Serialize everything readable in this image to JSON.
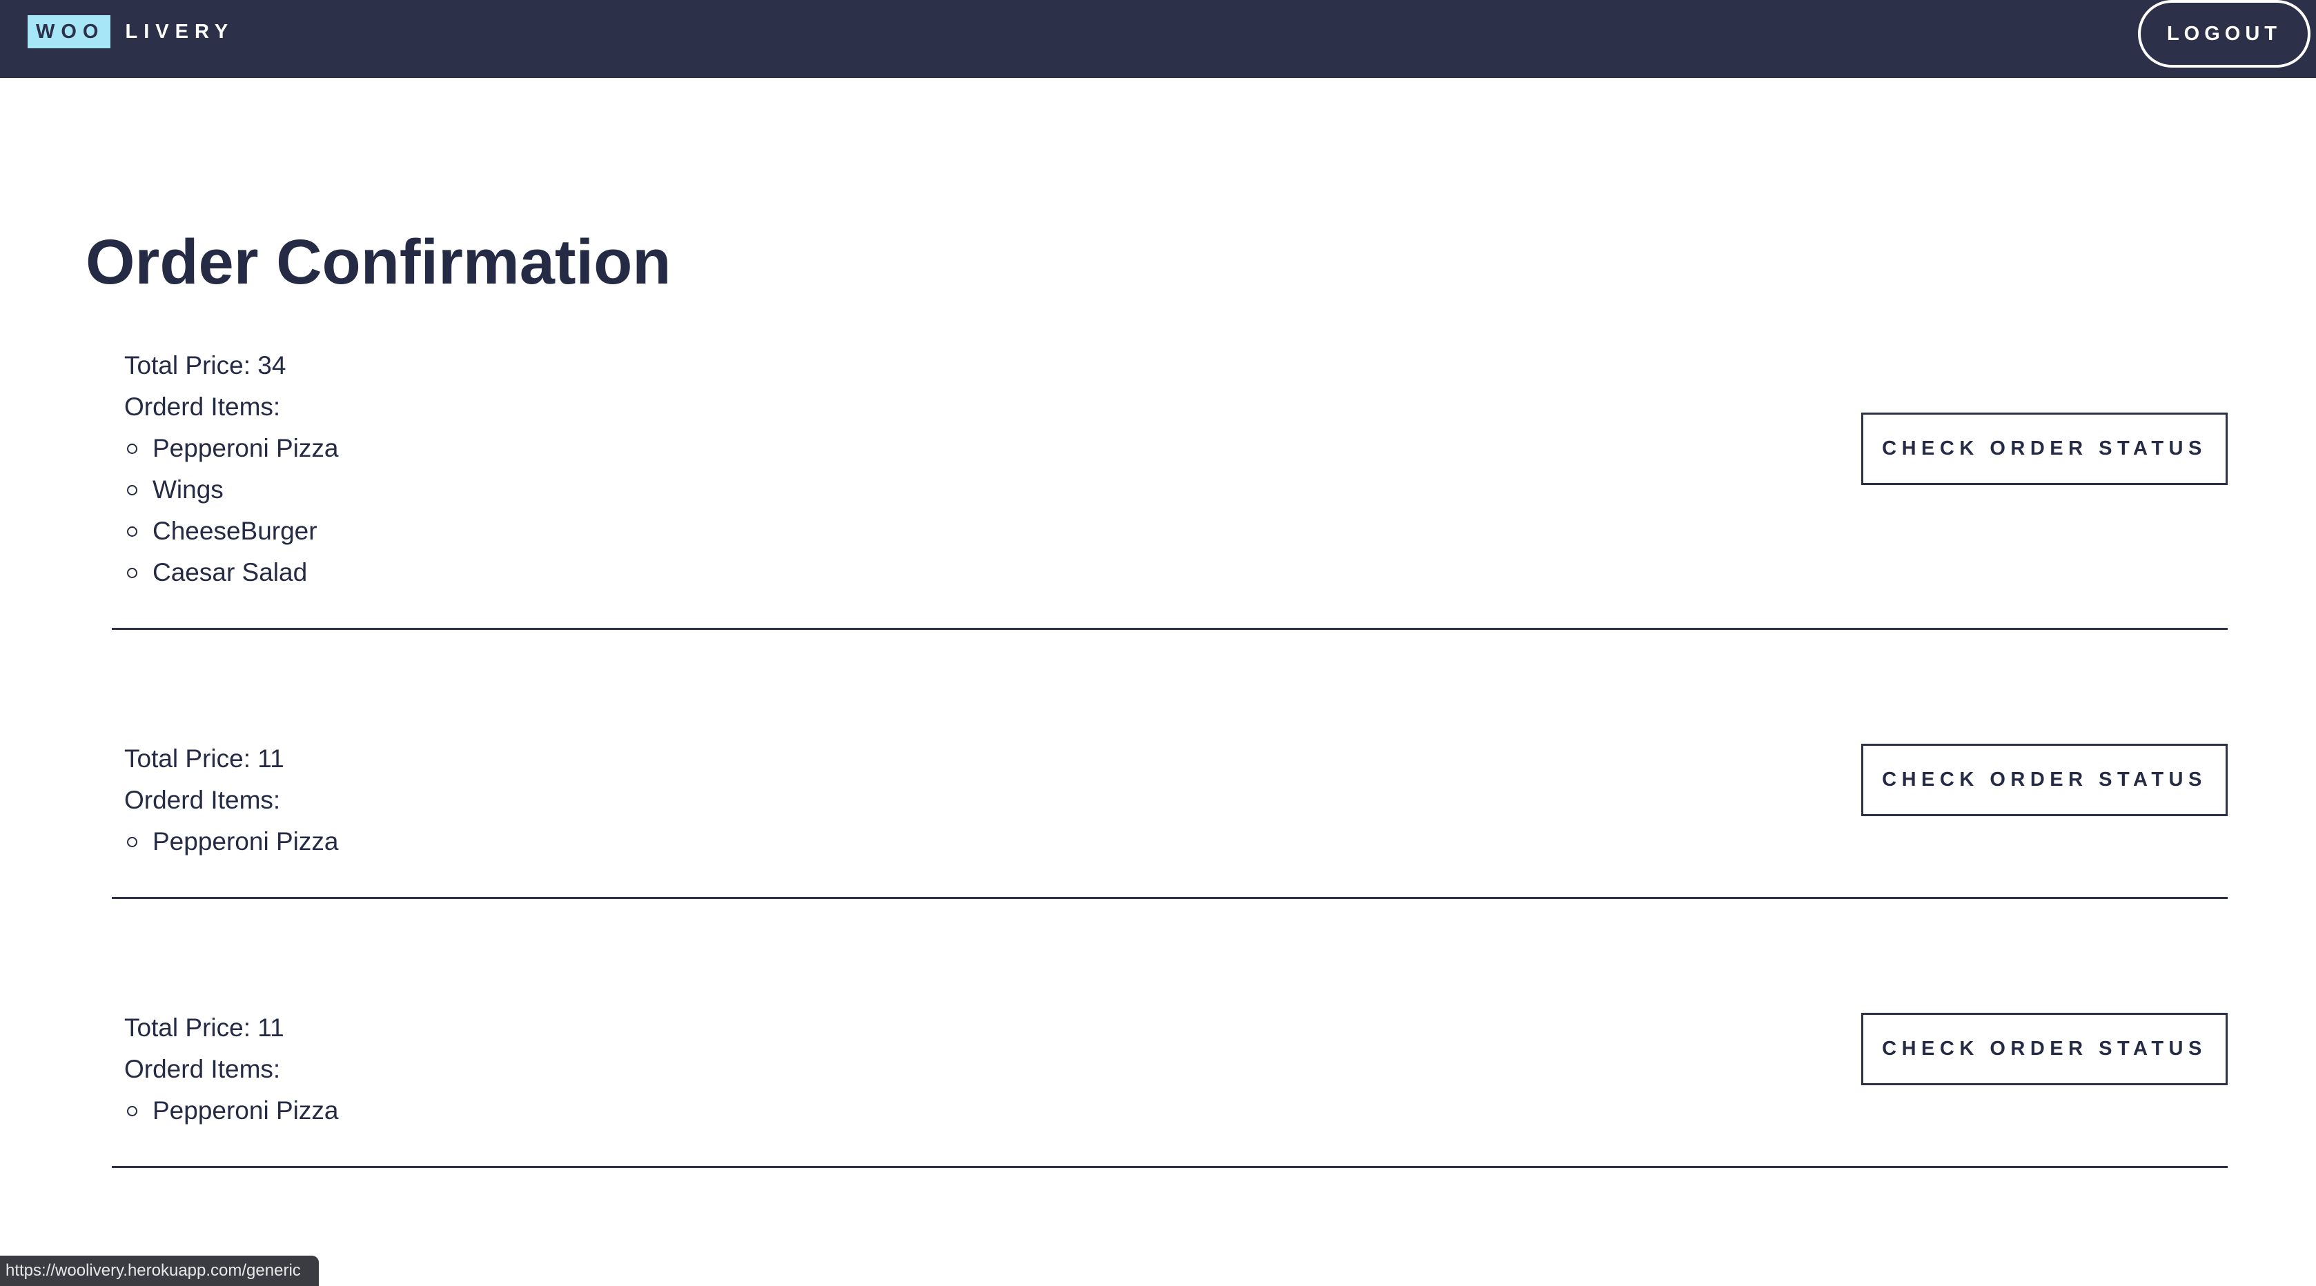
{
  "brand": {
    "woo": "WOO",
    "livery": "LIVERY"
  },
  "nav": {
    "logout_label": "LOGOUT"
  },
  "page": {
    "title": "Order Confirmation"
  },
  "orders": [
    {
      "total_price": "Total Price: 34",
      "items_label": "Orderd Items:",
      "items": [
        "Pepperoni Pizza",
        "Wings",
        "CheeseBurger",
        "Caesar Salad"
      ],
      "button_label": "CHECK ORDER STATUS"
    },
    {
      "total_price": "Total Price: 11",
      "items_label": "Orderd Items:",
      "items": [
        "Pepperoni Pizza"
      ],
      "button_label": "CHECK ORDER STATUS"
    },
    {
      "total_price": "Total Price: 11",
      "items_label": "Orderd Items:",
      "items": [
        "Pepperoni Pizza"
      ],
      "button_label": "CHECK ORDER STATUS"
    }
  ],
  "status_bar": {
    "url": "https://woolivery.herokuapp.com/generic"
  },
  "colors": {
    "navbar": "#2d3049",
    "brand_highlight": "#a7e6f7",
    "text": "#262b45"
  }
}
